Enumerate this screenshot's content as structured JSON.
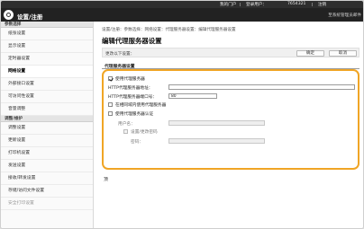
{
  "topbar": {
    "items": [
      "我的门户",
      "登录用户：",
      "7654321",
      "注销"
    ]
  },
  "header": {
    "title": "设置/注册",
    "right_link": "至系统管理员邮件"
  },
  "sidebar": {
    "section1": "参数选择",
    "items1": [
      "纸张设置",
      "显示设置",
      "定时器设置",
      "网络设置",
      "外部接口设置",
      "可访问性设置",
      "音量调整"
    ],
    "section2": "调整/维护",
    "items2": [
      "调整设置",
      "更新设置",
      "打印机设置",
      "发送设置",
      "接收/转发设置",
      "存储/访问文件设置",
      "安全打印设置"
    ]
  },
  "main": {
    "breadcrumb": "设置/注册：参数选择：网络设置：代理服务器设置：编辑代理服务器设置",
    "title": "编辑代理服务器设置",
    "hint": "更改以下设置：",
    "ok_label": "确定",
    "cancel_label": "取消",
    "section_title": "代理服务器设置",
    "use_proxy_label": "使用代理服务器",
    "http_address_label": "HTTP代理服务器地址：",
    "http_address_value": "",
    "http_port_label": "HTTP代理服务器端口号：",
    "http_port_value": "80",
    "same_domain_label": "在相同域内使用代理服务器",
    "use_auth_label": "使用代理服务器认证",
    "username_label": "用户名：",
    "username_value": "",
    "confirm_password_label": "设置/更改密码",
    "password_label": "密码：",
    "password_value": "",
    "footnote": "顶"
  }
}
